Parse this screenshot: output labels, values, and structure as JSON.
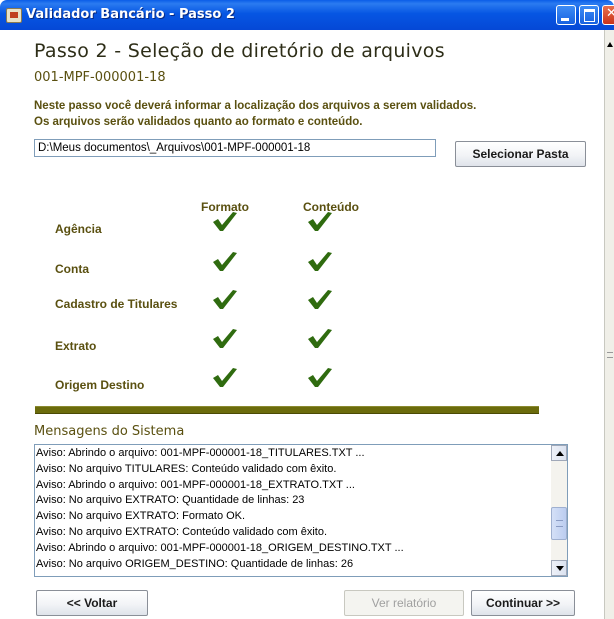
{
  "window": {
    "title": "Validador Bancário - Passo 2"
  },
  "header": {
    "title": "Passo 2 - Seleção de diretório de arquivos",
    "subtitle": "001-MPF-000001-18",
    "instruction_line1": "Neste passo você deverá informar a localização dos arquivos a serem validados.",
    "instruction_line2": "Os arquivos serão validados quanto ao formato e conteúdo."
  },
  "folder": {
    "path": "D:\\Meus documentos\\_Arquivos\\001-MPF-000001-18",
    "select_button": "Selecionar Pasta"
  },
  "validation": {
    "columns": [
      "Formato",
      "Conteúdo"
    ],
    "check_color": "#2f6b0f",
    "rows": [
      {
        "label": "Agência",
        "formato": "ok",
        "conteudo": "ok"
      },
      {
        "label": "Conta",
        "formato": "ok",
        "conteudo": "ok"
      },
      {
        "label": "Cadastro de Titulares",
        "formato": "ok",
        "conteudo": "ok"
      },
      {
        "label": "Extrato",
        "formato": "ok",
        "conteudo": "ok"
      },
      {
        "label": "Origem Destino",
        "formato": "ok",
        "conteudo": "ok"
      }
    ]
  },
  "messages": {
    "title": "Mensagens do Sistema",
    "lines": [
      "Aviso: Abrindo o arquivo: 001-MPF-000001-18_TITULARES.TXT ...",
      "Aviso: No arquivo TITULARES: Conteúdo validado com êxito.",
      "Aviso: Abrindo o arquivo: 001-MPF-000001-18_EXTRATO.TXT ...",
      "Aviso: No arquivo EXTRATO: Quantidade de linhas: 23",
      "Aviso: No arquivo EXTRATO: Formato OK.",
      "Aviso: No arquivo EXTRATO: Conteúdo validado com êxito.",
      "Aviso: Abrindo o arquivo: 001-MPF-000001-18_ORIGEM_DESTINO.TXT ...",
      "Aviso: No arquivo ORIGEM_DESTINO: Quantidade de linhas: 26"
    ]
  },
  "footer": {
    "back_button": "<< Voltar",
    "report_button": "Ver relatório",
    "continue_button": "Continuar >>"
  }
}
